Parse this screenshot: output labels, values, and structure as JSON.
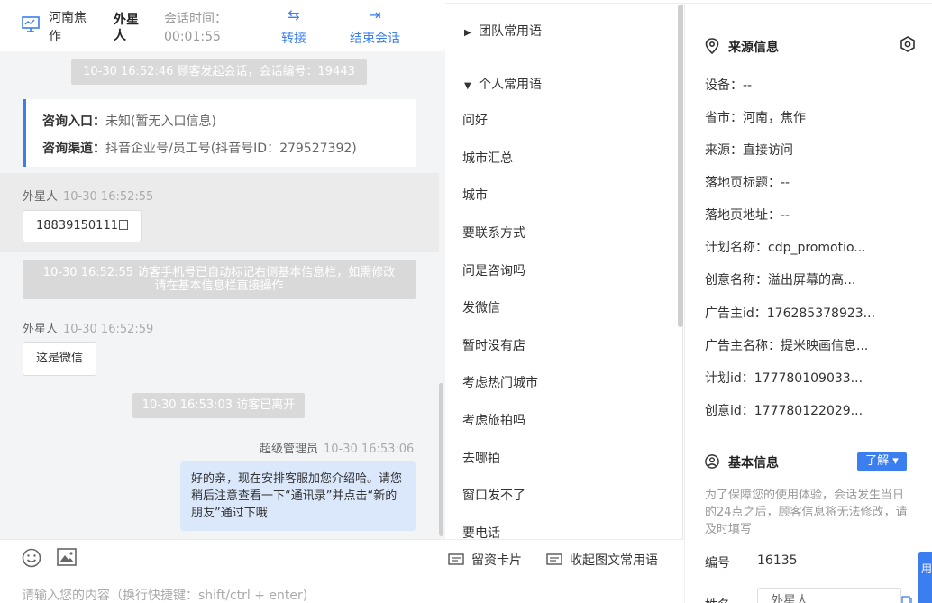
{
  "header": {
    "location": "河南焦作",
    "visitor_name": "外星人",
    "time_label": "会话时间：",
    "time_value": "00:01:55",
    "transfer_label": "转接",
    "end_label": "结束会话"
  },
  "messages": {
    "sys1": "10-30 16:52:46 顾客发起会话，会话编号：19443",
    "entry_label": "咨询入口：",
    "entry_value": "未知(暂无入口信息)",
    "channel_label": "咨询渠道：",
    "channel_value": "抖音企业号/员工号(抖音号ID：279527392)",
    "m1_sender": "外星人",
    "m1_time": "10-30 16:52:55",
    "m1_text": "18839150111",
    "sys2_line1": "10-30 16:52:55 访客手机号已自动标记右侧基本信息栏，如需修改",
    "sys2_line2": "请在基本信息栏直接操作",
    "m2_sender": "外星人",
    "m2_time": "10-30 16:52:59",
    "m2_text": "这是微信",
    "sys3": "10-30 16:53:03 访客已离开",
    "m3_sender": "超级管理员",
    "m3_time": "10-30 16:53:06",
    "m3_text": "好的亲，现在安排客服加您介绍哈。请您稍后注意查看一下“通讯录”并点击“新的朋友”通过下哦"
  },
  "input": {
    "placeholder": "请输入您的内容（换行快捷键：shift/ctrl + enter)"
  },
  "phrases": {
    "team_group": "团队常用语",
    "personal_group": "个人常用语",
    "items": [
      "问好",
      "城市汇总",
      "城市",
      "要联系方式",
      "问是咨询吗",
      "发微信",
      "暂时没有店",
      "考虑热门城市",
      "考虑旅拍吗",
      "去哪拍",
      "窗口发不了",
      "要电话"
    ],
    "footer_card": "留资卡片",
    "footer_collapse": "收起图文常用语"
  },
  "source": {
    "title": "来源信息",
    "device": "设备：--",
    "province": "省市：河南，焦作",
    "origin": "来源：直接访问",
    "landing_title": "落地页标题：--",
    "landing_url": "落地页地址：--",
    "plan_name": "计划名称：cdp_promotio...",
    "creative_name": "创意名称：溢出屏幕的高...",
    "advertiser_id": "广告主id：176285378923...",
    "advertiser_name": "广告主名称：提米映画信息...",
    "plan_id": "计划id：177780109033...",
    "creative_id": "创意id：177780122029..."
  },
  "basic": {
    "title": "基本信息",
    "learn_btn": "了解 ▾",
    "notice": "为了保障您的使用体验，会话发生当日的24点之后，顾客信息将无法修改，请及时填写",
    "id_label": "编号",
    "id_value": "16135",
    "name_label": "姓名",
    "name_value": "外星人"
  },
  "float_tab": "用",
  "colors": {
    "accent": "#3a7ef0",
    "sys_bg": "#d9d9d9",
    "bubble_blue": "#dbe8fb"
  }
}
